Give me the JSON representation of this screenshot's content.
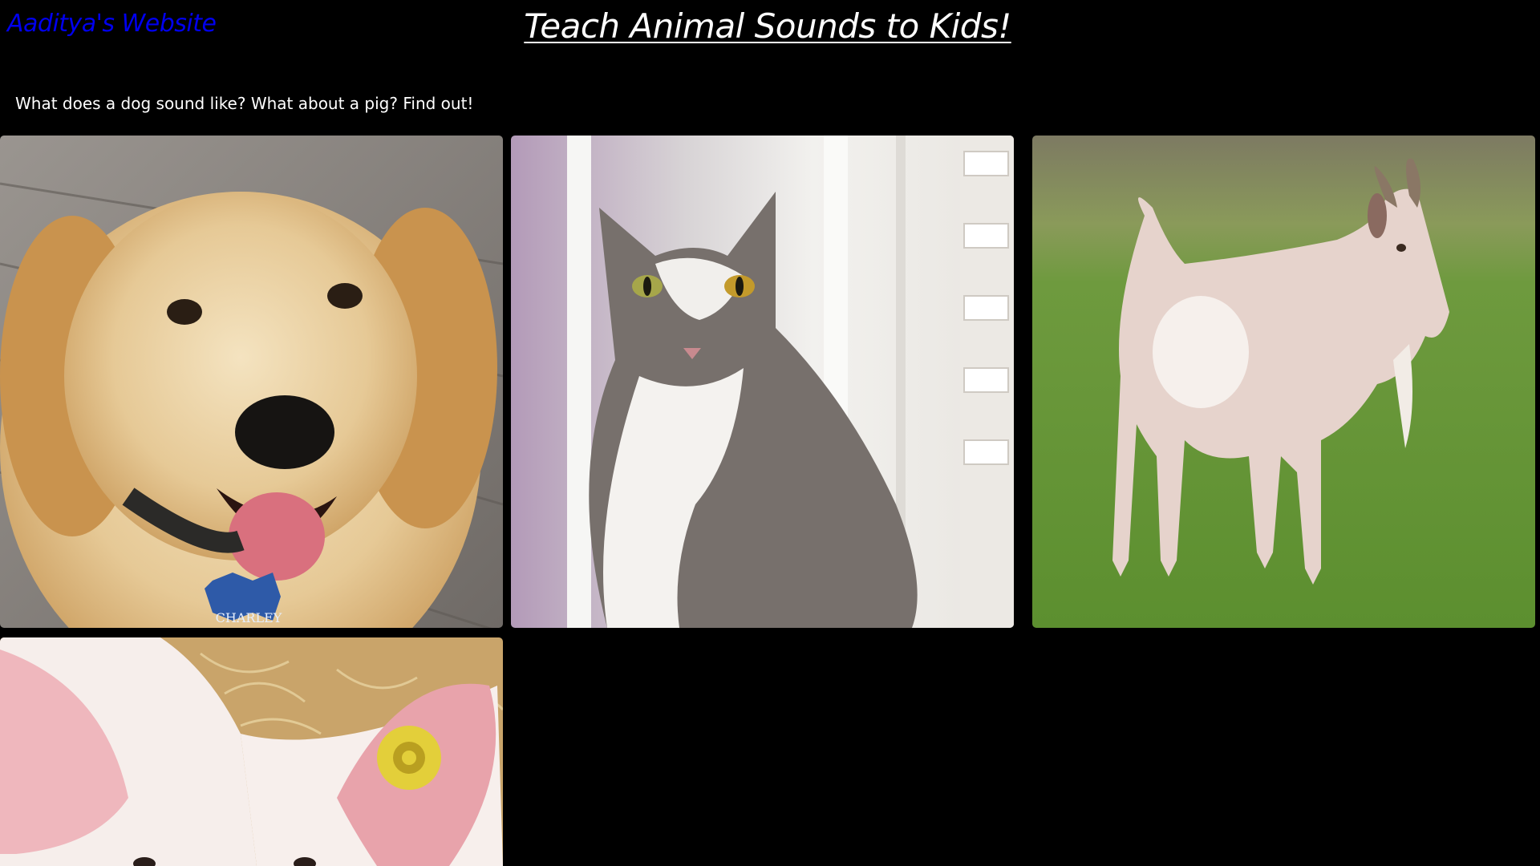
{
  "header": {
    "site_link": "Aaditya's Website",
    "title": "Teach Animal Sounds to Kids!"
  },
  "intro": {
    "text": "What does a dog sound like? What about a pig? Find out!"
  },
  "gallery": {
    "tiles": [
      {
        "animal": "dog",
        "tag_text": "CHARLEY"
      },
      {
        "animal": "cat"
      },
      {
        "animal": "goat"
      },
      {
        "animal": "pig"
      }
    ]
  },
  "colors": {
    "background": "#000000",
    "link": "#0000ee",
    "text": "#ffffff"
  }
}
